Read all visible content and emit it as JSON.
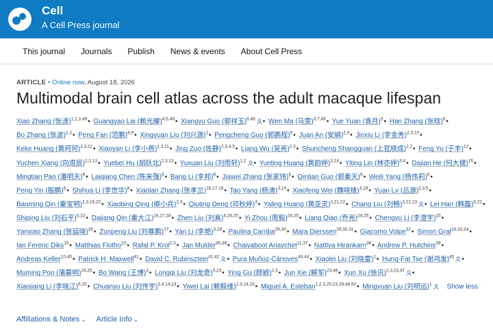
{
  "brand": {
    "title": "Cell",
    "subtitle": "A Cell Press journal",
    "accent": "#0e7bc2"
  },
  "nav": [
    {
      "label": "This journal"
    },
    {
      "label": "Journals"
    },
    {
      "label": "Publish"
    },
    {
      "label": "News & events"
    },
    {
      "label": "About Cell Press"
    }
  ],
  "meta": {
    "type": "ARTICLE",
    "bullet": "•",
    "status": "Online now",
    "date": ", August 18, 2026"
  },
  "title": "Multimodal brain cell atlas across the adult macaque lifespan",
  "authors": [
    {
      "name": "Xiao Zhang (张潇)",
      "aff": "1,2,3,49"
    },
    {
      "name": "Guangyao Lai (赖光耀)",
      "aff": "4,5,49"
    },
    {
      "name": "Xiangyu Guo (郭祥玉)",
      "aff": "6,49"
    },
    {
      "name": "Wen Ma (马雯)",
      "aff": "3,7,49"
    },
    {
      "name": "Yue Yuan (袁月)",
      "aff": "5"
    },
    {
      "name": "Han Zhang (张晗)",
      "aff": "6"
    },
    {
      "name": "Bo Zhang (张波)",
      "aff": "1,2"
    },
    {
      "name": "Peng Fan (范鹏)",
      "aff": "8,9"
    },
    {
      "name": "Xingyuan Liu (刘兴源)",
      "aff": "1"
    },
    {
      "name": "Pengcheng Guo (郭鹏程)",
      "aff": "5"
    },
    {
      "name": "Juan An (安娟)",
      "aff": "2,3"
    },
    {
      "name": "Jinxiu Li (李金秀)",
      "aff": "2,3,10"
    },
    {
      "name": "Keke Huang (黄珂珂)",
      "aff": "2,3,11"
    },
    {
      "name": "Xiaoyan Li (李小燕)",
      "aff": "2,3,11"
    },
    {
      "name": "Jing Zuo (佐静)",
      "aff": "2,3,4,5"
    },
    {
      "name": "Liang Wu (吴亮)",
      "aff": "2,3"
    },
    {
      "name": "Shuncheng Shangguan (上官顺成)",
      "aff": "1,2"
    },
    {
      "name": "Feng Yu (于丰)",
      "aff": "12"
    },
    {
      "name": "Yuchen Xiang (向煜辰)",
      "aff": "2,3,13"
    },
    {
      "name": "Yuebei Hu (胡跃北)",
      "aff": "2,3,13"
    },
    {
      "name": "Yuxuan Liu (刘雨轩)",
      "aff": "1,2"
    },
    {
      "name": "Yunting Huang (黄韵婷)",
      "aff": "3,14"
    },
    {
      "name": "Yiting Lin (林亦婷)",
      "aff": "3,4"
    },
    {
      "name": "Dajian He (何大健)",
      "aff": "15"
    },
    {
      "name": "Mingtian Pan (潘明天)",
      "aff": "6"
    },
    {
      "name": "Laiqiang Chen (陈来强)",
      "aff": "6"
    },
    {
      "name": "Bang Li (李邦)",
      "aff": "6"
    },
    {
      "name": "Jiawei Zhang (张家玮)",
      "aff": "6"
    },
    {
      "name": "Qintian Guo (郭秦天)",
      "aff": "6"
    },
    {
      "name": "Weili Yang (杨伟莉)",
      "aff": "6"
    },
    {
      "name": "Peng Yin (殷鹏)",
      "aff": "6"
    },
    {
      "name": "Shihua Li (李世华)",
      "aff": "6"
    },
    {
      "name": "Xiaolan Zhang (张孝兰)",
      "aff": "16,17,18"
    },
    {
      "name": "Tao Yang (杨涛)",
      "aff": "3,19"
    },
    {
      "name": "Xiaofeng Wei (魏晓锋)",
      "aff": "3,19"
    },
    {
      "name": "Yuan Lv (吕源)",
      "aff": "2,3,5"
    },
    {
      "name": "Baoming Qin (秦宝明)",
      "aff": "2,3,16,20"
    },
    {
      "name": "Xiaobing Qing (卿小兵)",
      "aff": "2,3"
    },
    {
      "name": "Qiuting Deng (邓秋婷)",
      "aff": "3"
    },
    {
      "name": "Yaling Huang (黄亚灵)",
      "aff": "3,21,22"
    },
    {
      "name": "Chang Liu (刘畅)",
      "aff": "3,22,23"
    },
    {
      "name": "Lei Han (韩磊)",
      "aff": "5,22"
    },
    {
      "name": "Shiping Liu (刘石平)",
      "aff": "5,22"
    },
    {
      "name": "Dajiang Qin (秦大江)",
      "aff": "16,17,18"
    },
    {
      "name": "Zhen Liu (刘真)",
      "aff": "4,24,25"
    },
    {
      "name": "Yi Zhou (周毅)",
      "aff": "24,25"
    },
    {
      "name": "Liang Qiao (乔亮)",
      "aff": "24,25"
    },
    {
      "name": "Chengyu Li (李澄宇)",
      "aff": "15"
    },
    {
      "name": "Yanxiao Zhang (张延晓)",
      "aff": "26"
    },
    {
      "name": "Zunpeng Liu (刘尊鹏)",
      "aff": "27"
    },
    {
      "name": "Yan Li (李艳)",
      "aff": "3,28"
    },
    {
      "name": "Paulina Carriba",
      "aff": "29,30"
    },
    {
      "name": "Mara Dierssen",
      "aff": "29,30,31"
    },
    {
      "name": "Giacomo Volpe",
      "aff": "32"
    },
    {
      "name": "Simon Graf",
      "aff": "10,33,34"
    },
    {
      "name": "Ian Ferenc Diks",
      "aff": "10"
    },
    {
      "name": "Matthias Flotho",
      "aff": "10"
    },
    {
      "name": "Rafal P. Krol",
      "aff": "2,3"
    },
    {
      "name": "Jan Mulder",
      "aff": "35,36"
    },
    {
      "name": "Chaiyaboot Ariaychet",
      "aff": "11,37"
    },
    {
      "name": "Nattiya Hirankarn",
      "aff": "38"
    },
    {
      "name": "Andrew P. Hutchins",
      "aff": "39"
    },
    {
      "name": "Andreas Keller",
      "aff": "10,40"
    },
    {
      "name": "Patrick H. Maxwell",
      "aff": "41"
    },
    {
      "name": "David C. Rubinsztein",
      "aff": "41,42"
    },
    {
      "name": "Pura Muñoz-Cánoves",
      "aff": "43,44"
    },
    {
      "name": "Xiaolei Liu (刘晓雷)",
      "aff": "1"
    },
    {
      "name": "Hung-Fat Tse (谢鸿发)",
      "aff": "45"
    },
    {
      "name": "Muming Poo (蒲慕明)",
      "aff": "24,25"
    },
    {
      "name": "Bo Wang (王博)",
      "aff": "3"
    },
    {
      "name": "Longqi Liu (刘龙奇)",
      "aff": "5,23"
    },
    {
      "name": "Ying Gu (顾颖)",
      "aff": "2,3"
    },
    {
      "name": "Jun Xie (解军)",
      "aff": "23,46"
    },
    {
      "name": "Xun Xu (徐讯)",
      "aff": "2,3,23,47"
    },
    {
      "name": "Xiaojiang Li (李晓江)",
      "aff": "6,15"
    },
    {
      "name": "Chuanyu Liu (刘传宇)",
      "aff": "3,4,14,23"
    },
    {
      "name": "Yiwei Lai (赖毅维)",
      "aff": "2,3,14,23"
    },
    {
      "name": "Miguel A. Esteban",
      "aff": "1,2,3,20,23,28,48,50"
    },
    {
      "name": "Mingyuan Liu (刘明远)",
      "aff": "1"
    }
  ],
  "email_authors": [
    2,
    20,
    40,
    64,
    67,
    73,
    78,
    79
  ],
  "show_less": "Show less",
  "footer_links": [
    {
      "label": "Affiliations & Notes"
    },
    {
      "label": "Article Info"
    }
  ]
}
